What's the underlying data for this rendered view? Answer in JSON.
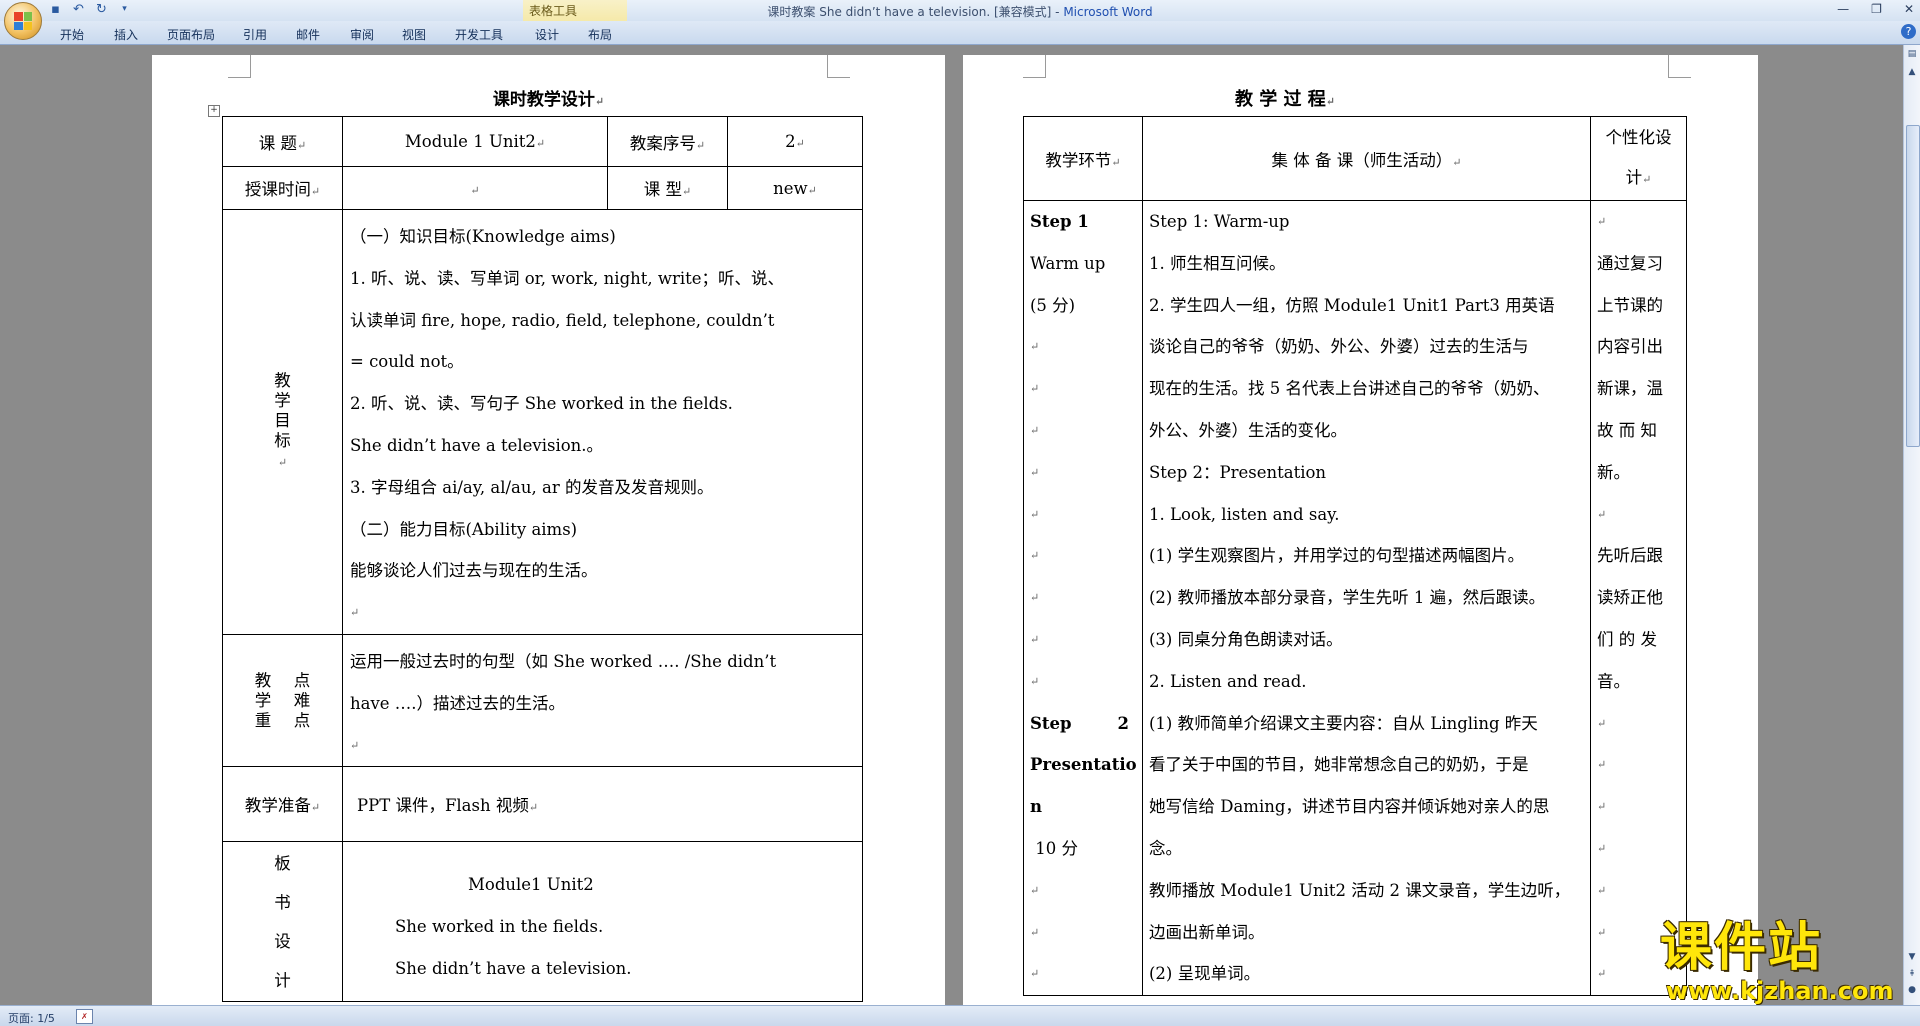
{
  "window": {
    "title_doc": "课时教案 She didn’t have a television. [兼容模式] - ",
    "title_app": "Microsoft Word",
    "context_group": "表格工具"
  },
  "ribbon": {
    "tabs": [
      "开始",
      "插入",
      "页面布局",
      "引用",
      "邮件",
      "审阅",
      "视图",
      "开发工具",
      "设计",
      "布局"
    ]
  },
  "page1": {
    "title": "课时教学设计",
    "row1": {
      "k1": "课  题",
      "v1": "Module 1 Unit2",
      "k2": "教案序号",
      "v2": "2"
    },
    "row2": {
      "k1": "授课时间",
      "v1": "",
      "k2": "课  型",
      "v2": "new"
    },
    "goals_label": [
      "教",
      "学",
      "目",
      "标"
    ],
    "goals_lines": [
      "（一）知识目标(Knowledge aims)",
      "1. 听、说、读、写单词 or, work, night, write；听、说、",
      "认读单词 fire, hope, radio, field, telephone, couldn’t",
      "= could not。",
      "2. 听、说、读、写句子 She worked in the fields.",
      " She didn’t have a television.。",
      "3. 字母组合 ai/ay, al/au, ar 的发音及发音规则。",
      "（二）能力目标(Ability aims)",
      "能够谈论人们过去与现在的生活。"
    ],
    "key_label_left": [
      "教",
      "学",
      "重"
    ],
    "key_label_right": [
      "点",
      "难",
      "点"
    ],
    "key_lines": [
      "运用一般过去时的句型（如 She worked ….  /She didn’t",
      "have ….）描述过去的生活。"
    ],
    "prep_label": "教学准备",
    "prep_value": "PPT 课件，Flash 视频",
    "board_label": [
      "板",
      "书",
      "设",
      "计"
    ],
    "board_lines": [
      "Module1 Unit2",
      "She worked in the fields.",
      "She didn’t have a television."
    ]
  },
  "page2": {
    "title": "教 学 过 程",
    "headers": {
      "stage": "教学环节",
      "main": "集 体 备 课（师生活动）",
      "personal": [
        "个性化设",
        "计"
      ]
    },
    "stage_col": [
      "Step 1",
      "Warm up",
      "(5 分)",
      "",
      "",
      "",
      "",
      "",
      "",
      "",
      "",
      "",
      "",
      "Step        2",
      "Presentatio",
      "n",
      " 10 分",
      "",
      "",
      "",
      ""
    ],
    "main_col": [
      "Step 1: Warm-up",
      "1. 师生相互问候。",
      "2. 学生四人一组，仿照 Module1 Unit1 Part3 用英语",
      "谈论自己的爷爷（奶奶、外公、外婆）过去的生活与",
      "现在的生活。找 5 名代表上台讲述自己的爷爷（奶奶、",
      "外公、外婆）生活的变化。",
      "Step 2：Presentation",
      "1. Look, listen and say.",
      "(1) 学生观察图片，并用学过的句型描述两幅图片。",
      "(2) 教师播放本部分录音，学生先听 1 遍，然后跟读。",
      "(3) 同桌分角色朗读对话。",
      "2. Listen and read.",
      "(1) 教师简单介绍课文主要内容：自从 Lingling 昨天",
      "看了关于中国的节目，她非常想念自己的奶奶，于是",
      "她写信给 Daming，讲述节目内容并倾诉她对亲人的思",
      "念。",
      "教师播放 Module1 Unit2 活动 2 课文录音，学生边听，",
      "边画出新单词。",
      "(2) 呈现单词。"
    ],
    "personal_col": [
      "",
      "通过复习",
      "上节课的",
      "内容引出",
      "新课，温",
      "故 而 知",
      "新。",
      "",
      "先听后跟",
      "读矫正他",
      "们 的 发",
      "音。",
      "",
      "",
      "",
      "",
      "",
      "",
      ""
    ]
  },
  "statusbar": {
    "page": "页面: 1/5"
  },
  "watermark": {
    "main": "课件站",
    "url": "www.kjzhan.com"
  }
}
